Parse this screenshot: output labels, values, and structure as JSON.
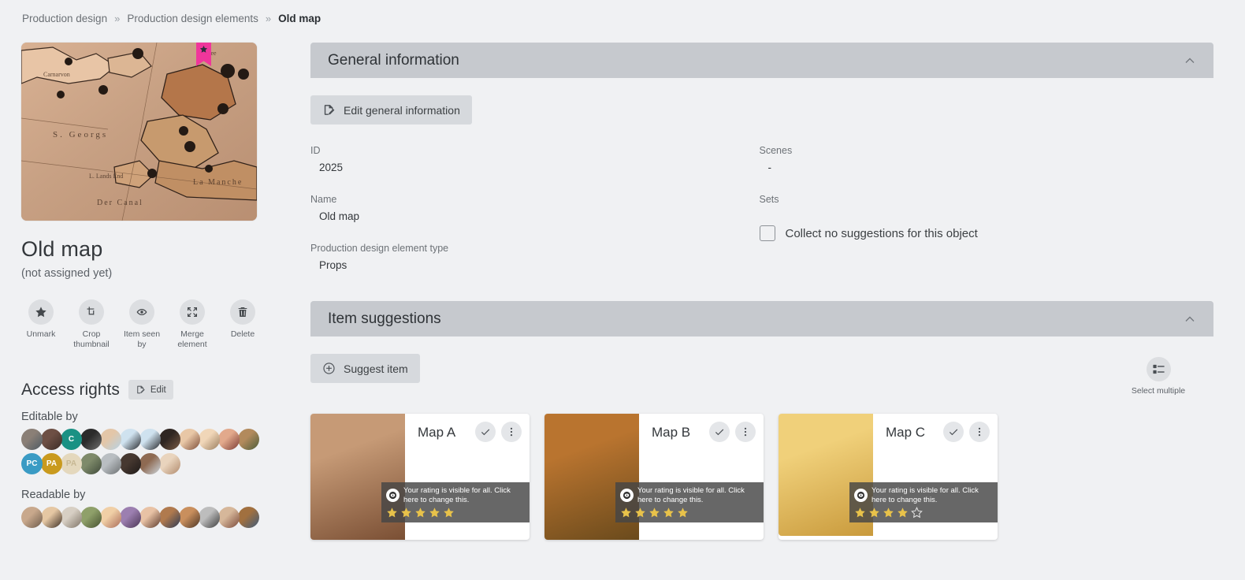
{
  "breadcrumb": [
    {
      "label": "Production design",
      "current": false
    },
    {
      "label": "Production design elements",
      "current": false
    },
    {
      "label": "Old map",
      "current": true
    }
  ],
  "breadcrumb_separator": "»",
  "object": {
    "title": "Old map",
    "assignment_status": "(not assigned yet)",
    "thumbnail_alt": "old-map-thumbnail",
    "bookmark_icon": "star-icon"
  },
  "actions": [
    {
      "label": "Unmark",
      "icon": "star-icon"
    },
    {
      "label": "Crop thumbnail",
      "icon": "crop-icon"
    },
    {
      "label": "Item seen by",
      "icon": "eye-icon"
    },
    {
      "label": "Merge element",
      "icon": "merge-icon"
    },
    {
      "label": "Delete",
      "icon": "trash-icon"
    }
  ],
  "access_rights": {
    "title": "Access rights",
    "edit_label": "Edit",
    "edit_icon": "edit-document-icon",
    "editable_by_label": "Editable by",
    "readable_by_label": "Readable by",
    "editable_by": [
      {
        "type": "photo",
        "c1": "#8a7f76",
        "c2": "#4e5a63"
      },
      {
        "type": "photo",
        "c1": "#6d4f44",
        "c2": "#3b2b26"
      },
      {
        "type": "initials",
        "text": "C",
        "bg": "#1a9184"
      },
      {
        "type": "photo",
        "c1": "#2b2b2b",
        "c2": "#6f6f6f"
      },
      {
        "type": "photo",
        "c1": "#e3c6a8",
        "c2": "#b6d3e5"
      },
      {
        "type": "photo",
        "c1": "#cfe2ef",
        "c2": "#24262a"
      },
      {
        "type": "photo",
        "c1": "#cfe2ef",
        "c2": "#24262a"
      },
      {
        "type": "photo",
        "c1": "#2f2622",
        "c2": "#7b5c46"
      },
      {
        "type": "photo",
        "c1": "#e8c7a6",
        "c2": "#7d4d39"
      },
      {
        "type": "photo",
        "c1": "#f0d6b8",
        "c2": "#9a7d5e"
      },
      {
        "type": "photo",
        "c1": "#e2a98c",
        "c2": "#7c3c35"
      },
      {
        "type": "photo",
        "c1": "#b28a5c",
        "c2": "#4b5d3a"
      },
      {
        "type": "initials",
        "text": "PC",
        "bg": "#3a9bc4"
      },
      {
        "type": "initials",
        "text": "PA",
        "bg": "#c99a1e"
      },
      {
        "type": "initials",
        "text": "PA",
        "bg": "#e4d8bd"
      },
      {
        "type": "photo",
        "c1": "#7e8a6a",
        "c2": "#3f4a3a"
      },
      {
        "type": "photo",
        "c1": "#b9bec2",
        "c2": "#6b6f70"
      },
      {
        "type": "photo",
        "c1": "#463830",
        "c2": "#1e1a18"
      },
      {
        "type": "photo",
        "c1": "#8e6a52",
        "c2": "#cdd7de"
      },
      {
        "type": "photo",
        "c1": "#e9d4bd",
        "c2": "#b08a6c"
      }
    ],
    "readable_by": [
      {
        "type": "photo",
        "c1": "#c8a88c",
        "c2": "#6b5a4a"
      },
      {
        "type": "photo",
        "c1": "#e5c7a3",
        "c2": "#3a2d24"
      },
      {
        "type": "photo",
        "c1": "#d7cfc4",
        "c2": "#7e7366"
      },
      {
        "type": "photo",
        "c1": "#8fa06a",
        "c2": "#45502f"
      },
      {
        "type": "photo",
        "c1": "#f0cfa6",
        "c2": "#a96a58"
      },
      {
        "type": "photo",
        "c1": "#9c7fb0",
        "c2": "#4a3553"
      },
      {
        "type": "photo",
        "c1": "#e8c2a5",
        "c2": "#5c3a2c"
      },
      {
        "type": "photo",
        "c1": "#b07a4e",
        "c2": "#2c3a54"
      },
      {
        "type": "photo",
        "c1": "#c98f5d",
        "c2": "#4b3526"
      },
      {
        "type": "photo",
        "c1": "#bdbdbd",
        "c2": "#3d3d3d"
      },
      {
        "type": "photo",
        "c1": "#d6b79a",
        "c2": "#7b4a3a"
      },
      {
        "type": "photo",
        "c1": "#a1703f",
        "c2": "#3d5b7a"
      }
    ]
  },
  "general_information": {
    "title": "General information",
    "collapse_icon": "chevron-up-icon",
    "edit_button": {
      "label": "Edit general information",
      "icon": "edit-document-icon"
    },
    "left_fields": [
      {
        "label": "ID",
        "value": "2025"
      },
      {
        "label": "Name",
        "value": "Old map"
      },
      {
        "label": "Production design element type",
        "value": "Props"
      }
    ],
    "right_fields": [
      {
        "label": "Scenes",
        "value": "-"
      },
      {
        "label": "Sets",
        "value": ""
      }
    ],
    "checkbox": {
      "label": "Collect no suggestions for this object",
      "checked": false
    }
  },
  "item_suggestions": {
    "title": "Item suggestions",
    "collapse_icon": "chevron-up-icon",
    "suggest_button": {
      "label": "Suggest item",
      "icon": "plus-circle-icon"
    },
    "select_multiple": {
      "label": "Select multiple",
      "icon": "checklist-icon"
    },
    "rating_tooltip": "Your rating is visible for all. Click here to change this.",
    "cards": [
      {
        "title": "Map A",
        "rating": 5,
        "max_rating": 5,
        "approve_icon": "check-icon",
        "menu_icon": "more-vertical-icon",
        "thumb_alt": "map-a-thumbnail",
        "thumb_c1": "#c69a76",
        "thumb_c2": "#7a4f34"
      },
      {
        "title": "Map B",
        "rating": 5,
        "max_rating": 5,
        "approve_icon": "check-icon",
        "menu_icon": "more-vertical-icon",
        "thumb_alt": "map-b-thumbnail",
        "thumb_c1": "#b9742f",
        "thumb_c2": "#6a4a1c"
      },
      {
        "title": "Map C",
        "rating": 4,
        "max_rating": 5,
        "approve_icon": "check-icon",
        "menu_icon": "more-vertical-icon",
        "thumb_alt": "map-c-thumbnail",
        "thumb_c1": "#f0d07a",
        "thumb_c2": "#c99a3c"
      }
    ]
  },
  "colors": {
    "page_background": "#f0f1f3",
    "panel_header": "#c6c9ce",
    "button_grey": "#d6d9dd",
    "bookmark_pink": "#f0369b",
    "star_gold": "#e8c24a",
    "rating_overlay": "#464646"
  }
}
